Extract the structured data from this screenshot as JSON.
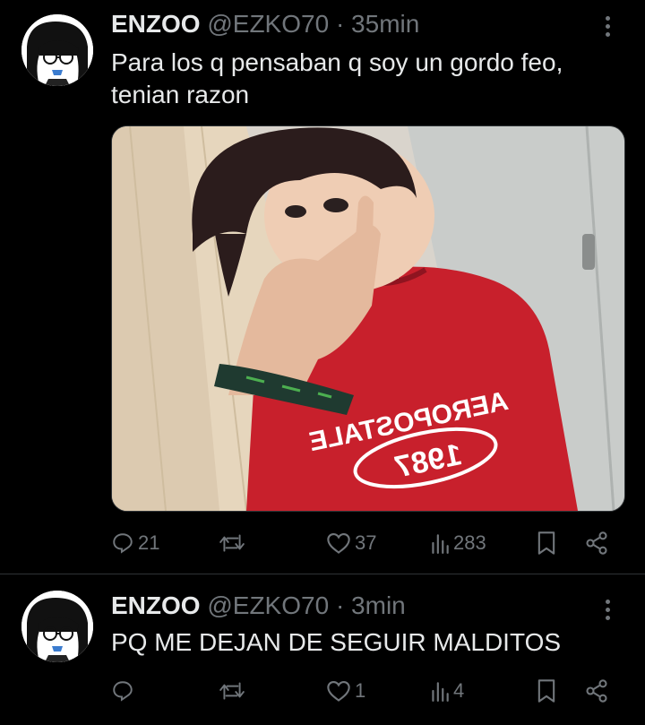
{
  "tweets": [
    {
      "author": {
        "name": "ENZOO",
        "handle": "@EZKO70"
      },
      "separator": "·",
      "time": "35min",
      "text": "Para los q pensaban q soy un gordo feo,\ntenian razon",
      "media": {
        "shirt_brand": "AEROPOSTALE",
        "shirt_year": "1987"
      },
      "stats": {
        "replies": "21",
        "reposts": "",
        "likes": "37",
        "views": "283"
      }
    },
    {
      "author": {
        "name": "ENZOO",
        "handle": "@EZKO70"
      },
      "separator": "·",
      "time": "3min",
      "text": "PQ ME DEJAN DE SEGUIR MALDITOS",
      "stats": {
        "replies": "",
        "reposts": "",
        "likes": "1",
        "views": "4"
      }
    }
  ],
  "icons": [
    "more-icon",
    "reply-icon",
    "repost-icon",
    "like-icon",
    "views-icon",
    "bookmark-icon",
    "share-icon"
  ],
  "colors": {
    "background": "#000000",
    "text": "#e7e9ea",
    "muted": "#71767b",
    "divider": "#2f3336",
    "shirt": "#c8202c"
  }
}
